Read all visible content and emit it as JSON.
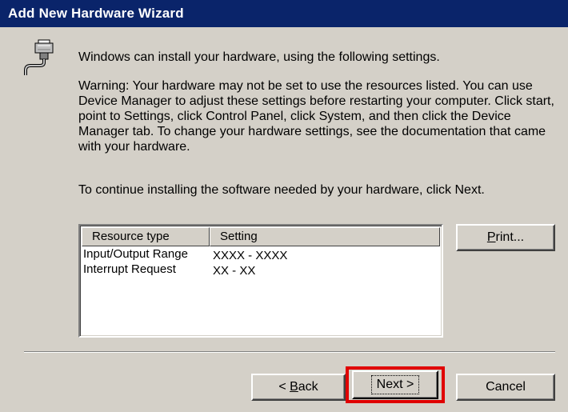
{
  "window": {
    "title": "Add New Hardware Wizard"
  },
  "icons": {
    "hardware": "hardware-device-icon"
  },
  "content": {
    "intro": "Windows can install your hardware, using the following settings.",
    "warning": "Warning:  Your hardware may not be set to use the resources listed. You can use Device Manager to adjust these settings before restarting your computer. Click start, point to Settings, click Control Panel, click System, and then click the Device Manager tab. To change your hardware settings, see the documentation that came with your hardware.",
    "continue": "To continue installing the software needed by your hardware, click Next."
  },
  "resources": {
    "columns": [
      "Resource type",
      "Setting"
    ],
    "rows": [
      {
        "type": "Input/Output Range",
        "setting": "XXXX - XXXX"
      },
      {
        "type": "Interrupt Request",
        "setting": "XX - XX"
      }
    ]
  },
  "buttons": {
    "print": {
      "mnemonic": "P",
      "rest": "rint..."
    },
    "back": {
      "prefix": "< ",
      "mnemonic": "B",
      "rest": "ack"
    },
    "next": "Next >",
    "cancel": "Cancel"
  },
  "colors": {
    "titlebar": "#0a246a",
    "face": "#d4d0c8",
    "highlight": "#e00000"
  }
}
